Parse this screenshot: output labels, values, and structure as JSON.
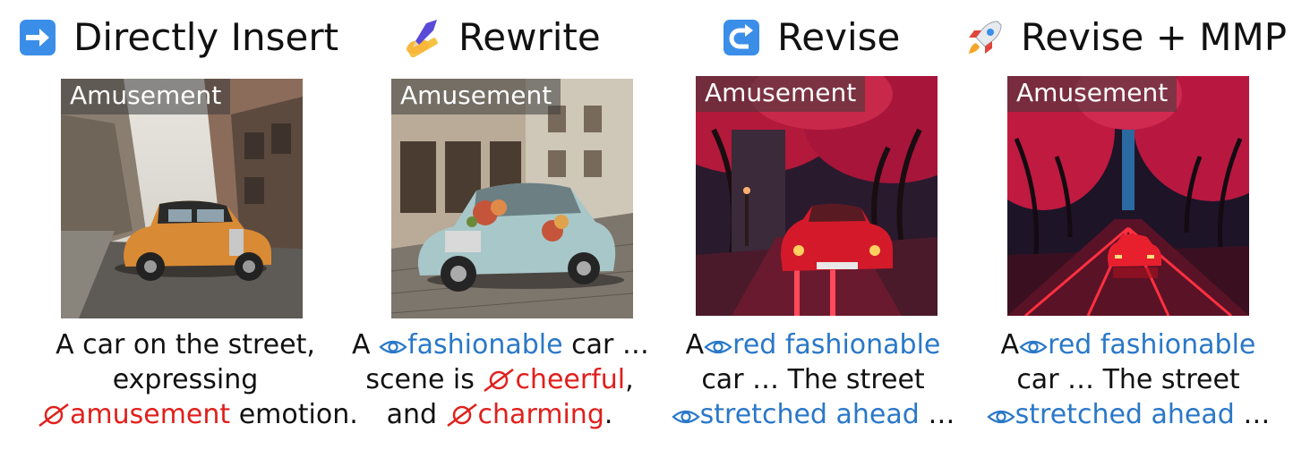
{
  "methods": [
    {
      "title": "Directly Insert",
      "icon": "right-arrow-icon"
    },
    {
      "title": "Rewrite",
      "icon": "writing-hand-icon"
    },
    {
      "title": "Revise",
      "icon": "return-arrow-icon"
    },
    {
      "title": "Revise + MMP",
      "icon": "rocket-icon"
    }
  ],
  "emotion_label": "Amusement",
  "captions": [
    {
      "line1": "A car on the street,",
      "line2": "expressing",
      "line3_red": "amusement",
      "line3_rest": " emotion."
    },
    {
      "line1_a": "A ",
      "line1_blue": "fashionable",
      "line1_rest": " car …",
      "line2_a": "scene is ",
      "line2_red": "cheerful",
      "line2_rest": ",",
      "line3_a": "and ",
      "line3_red": "charming",
      "line3_rest": "."
    },
    {
      "line1_a": "A",
      "line1_blue": "red fashionable",
      "line2": "car … The street",
      "line3_blue": "stretched ahead",
      "line3_rest": " …"
    },
    {
      "line1_a": "A",
      "line1_blue": "red fashionable",
      "line2": "car … The street",
      "line3_blue": "stretched ahead",
      "line3_rest": " …"
    }
  ],
  "colors": {
    "negative_red": "#e0201c",
    "positive_blue": "#2a78c8"
  }
}
